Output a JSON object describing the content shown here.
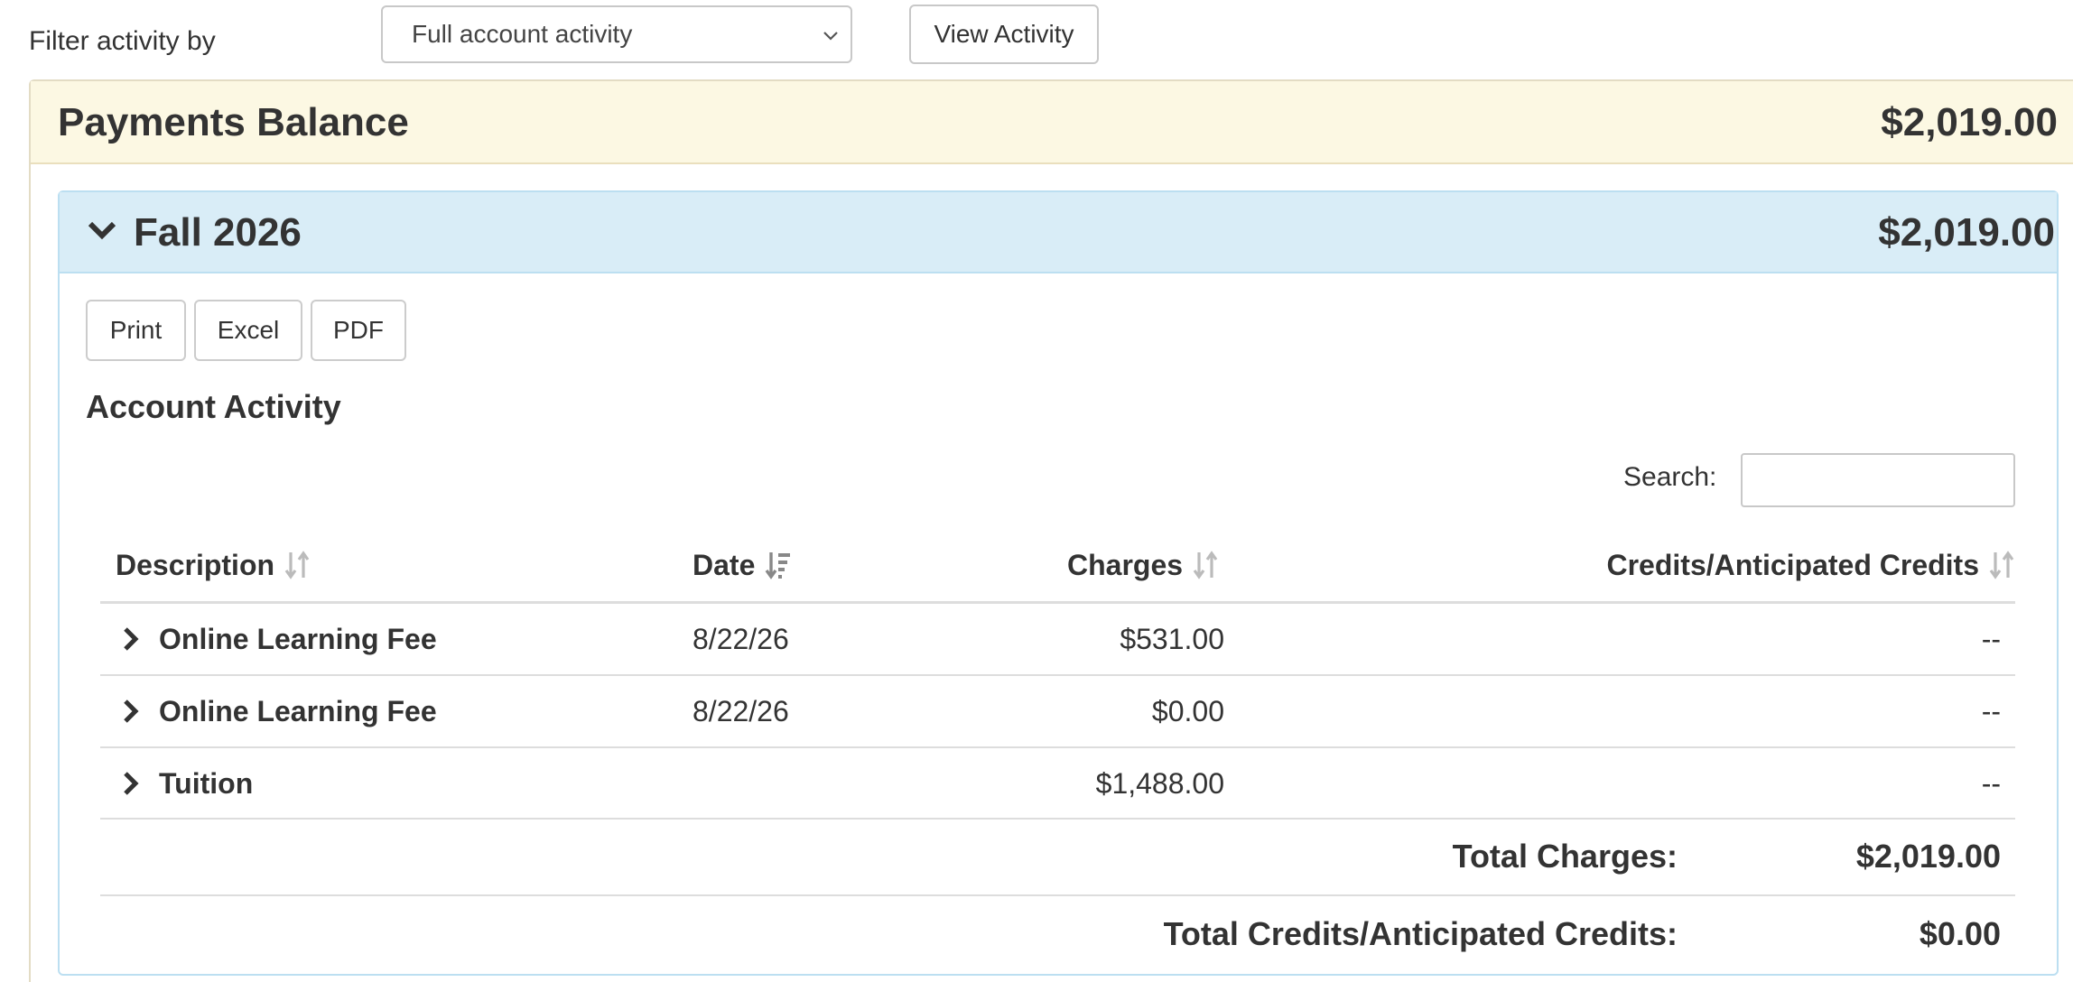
{
  "filter": {
    "label": "Filter activity by",
    "selected": "Full account activity",
    "view_button": "View Activity"
  },
  "balance": {
    "title": "Payments Balance",
    "amount": "$2,019.00"
  },
  "term": {
    "title": "Fall 2026",
    "amount": "$2,019.00"
  },
  "export": {
    "print": "Print",
    "excel": "Excel",
    "pdf": "PDF"
  },
  "activity": {
    "title": "Account Activity",
    "search_label": "Search:",
    "search_value": "",
    "columns": {
      "description": "Description",
      "date": "Date",
      "charges": "Charges",
      "credits": "Credits/Anticipated Credits"
    },
    "rows": [
      {
        "description": "Online Learning Fee",
        "date": "8/22/26",
        "charges": "$531.00",
        "credits": "--"
      },
      {
        "description": "Online Learning Fee",
        "date": "8/22/26",
        "charges": "$0.00",
        "credits": "--"
      },
      {
        "description": "Tuition",
        "date": "",
        "charges": "$1,488.00",
        "credits": "--"
      }
    ],
    "totals": {
      "charges_label": "Total Charges:",
      "charges_value": "$2,019.00",
      "credits_label": "Total Credits/Anticipated Credits:",
      "credits_value": "$0.00"
    }
  },
  "colors": {
    "balance_header_bg": "#fcf8e3",
    "term_header_bg": "#d9edf7",
    "text": "#333333",
    "sort_icon": "#b5b5b5",
    "border": "#dddddd"
  },
  "icons": {
    "select": "chevron-down-icon",
    "term_toggle": "chevron-down-icon",
    "row_expand": "chevron-right-icon",
    "sort": "sort-icon",
    "sort_active": "sort-descending-icon"
  }
}
